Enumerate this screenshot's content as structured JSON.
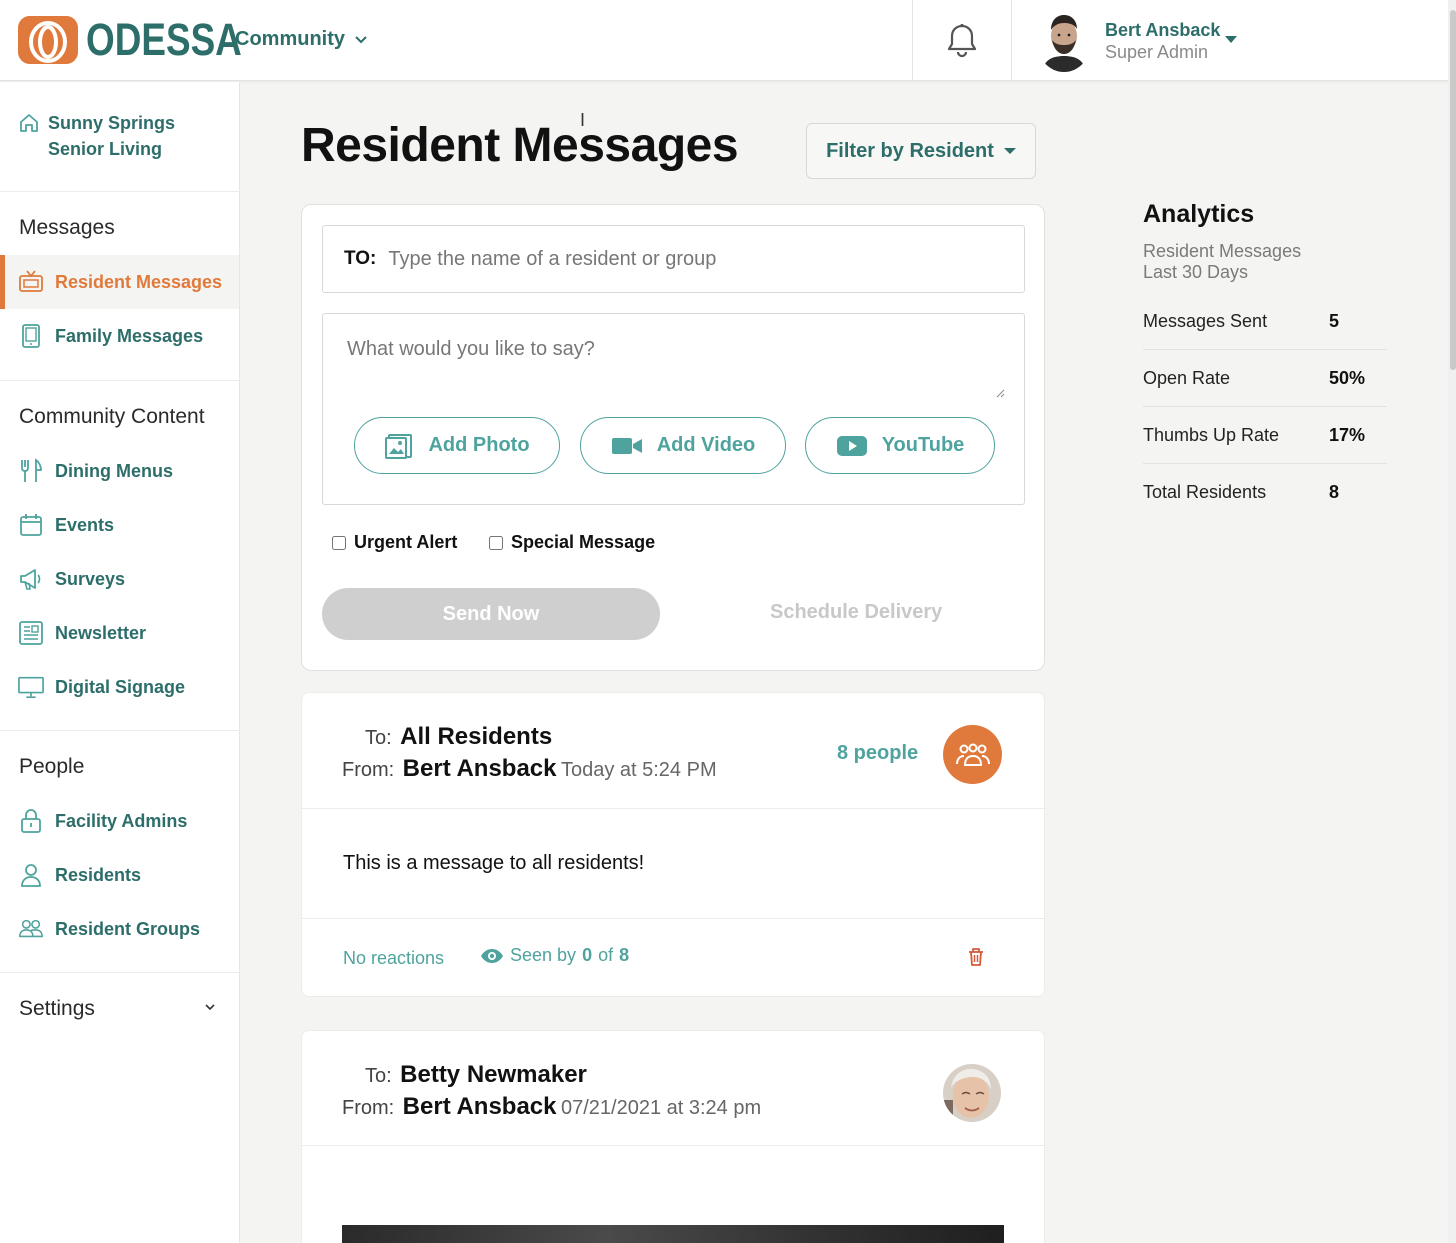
{
  "header": {
    "logo_text": "ODESSA",
    "community_label": "Community",
    "user_name": "Bert Ansback",
    "user_role": "Super Admin"
  },
  "sidebar": {
    "facility": "Sunny Springs Senior Living",
    "sections": {
      "messages": "Messages",
      "community_content": "Community Content",
      "people": "People",
      "settings": "Settings"
    },
    "items": {
      "resident_messages": "Resident Messages",
      "family_messages": "Family Messages",
      "dining_menus": "Dining Menus",
      "events": "Events",
      "surveys": "Surveys",
      "newsletter": "Newsletter",
      "digital_signage": "Digital Signage",
      "facility_admins": "Facility Admins",
      "residents": "Residents",
      "resident_groups": "Resident Groups"
    }
  },
  "main": {
    "title": "Resident Messages",
    "filter_label": "Filter by Resident",
    "compose": {
      "to_label": "TO:",
      "to_placeholder": "Type the name of a resident or group",
      "message_placeholder": "What would you like to say?",
      "add_photo": "Add Photo",
      "add_video": "Add Video",
      "youtube": "YouTube",
      "urgent_alert": "Urgent Alert",
      "special_message": "Special Message",
      "send_now": "Send Now",
      "schedule_delivery": "Schedule Delivery"
    },
    "messages": [
      {
        "to_label": "To:",
        "to": "All Residents",
        "from_label": "From:",
        "from": "Bert Ansback",
        "time": "Today at 5:24 PM",
        "people": "8 people",
        "body": "This is a message to all residents!",
        "reactions": "No reactions",
        "seen_prefix": "Seen by",
        "seen_count": "0",
        "seen_of": "of",
        "seen_total": "8"
      },
      {
        "to_label": "To:",
        "to": "Betty Newmaker",
        "from_label": "From:",
        "from": "Bert Ansback",
        "time": "07/21/2021 at 3:24 pm"
      }
    ]
  },
  "analytics": {
    "title": "Analytics",
    "subtitle_line1": "Resident Messages",
    "subtitle_line2": "Last 30 Days",
    "rows": [
      {
        "label": "Messages Sent",
        "value": "5"
      },
      {
        "label": "Open Rate",
        "value": "50%"
      },
      {
        "label": "Thumbs Up Rate",
        "value": "17%"
      },
      {
        "label": "Total Residents",
        "value": "8"
      }
    ]
  },
  "colors": {
    "brand_teal": "#2d6e6a",
    "accent_teal": "#4fa39e",
    "brand_orange": "#e07a3c"
  }
}
